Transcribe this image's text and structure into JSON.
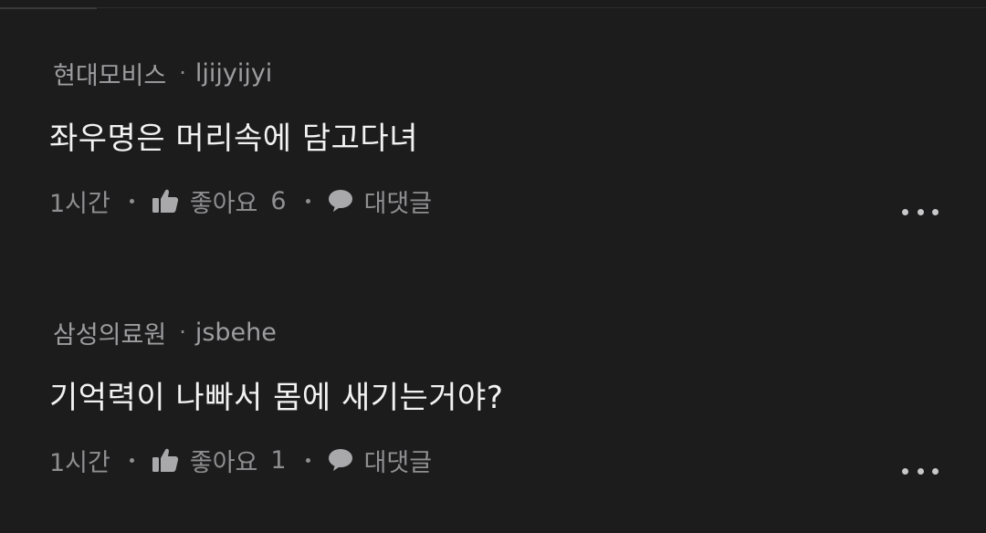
{
  "comments": [
    {
      "company": "현대모비스",
      "username": "ljijyijyi",
      "text": "좌우명은 머리속에 담고다녀",
      "time": "1시간",
      "like_label": "좋아요",
      "like_count": "6",
      "reply_label": "대댓글"
    },
    {
      "company": "삼성의료원",
      "username": "jsbehe",
      "text": "기억력이 나빠서 몸에 새기는거야?",
      "time": "1시간",
      "like_label": "좋아요",
      "like_count": "1",
      "reply_label": "대댓글"
    }
  ],
  "separator": "·",
  "icons": {
    "like": "thumbs-up-icon",
    "reply": "speech-bubble-icon",
    "more": "more-horizontal-icon"
  },
  "colors": {
    "background": "#1c1c1d",
    "meta_text": "#9d9d9f",
    "body_text": "#f2f2f2",
    "action_text": "#8f8f91"
  }
}
